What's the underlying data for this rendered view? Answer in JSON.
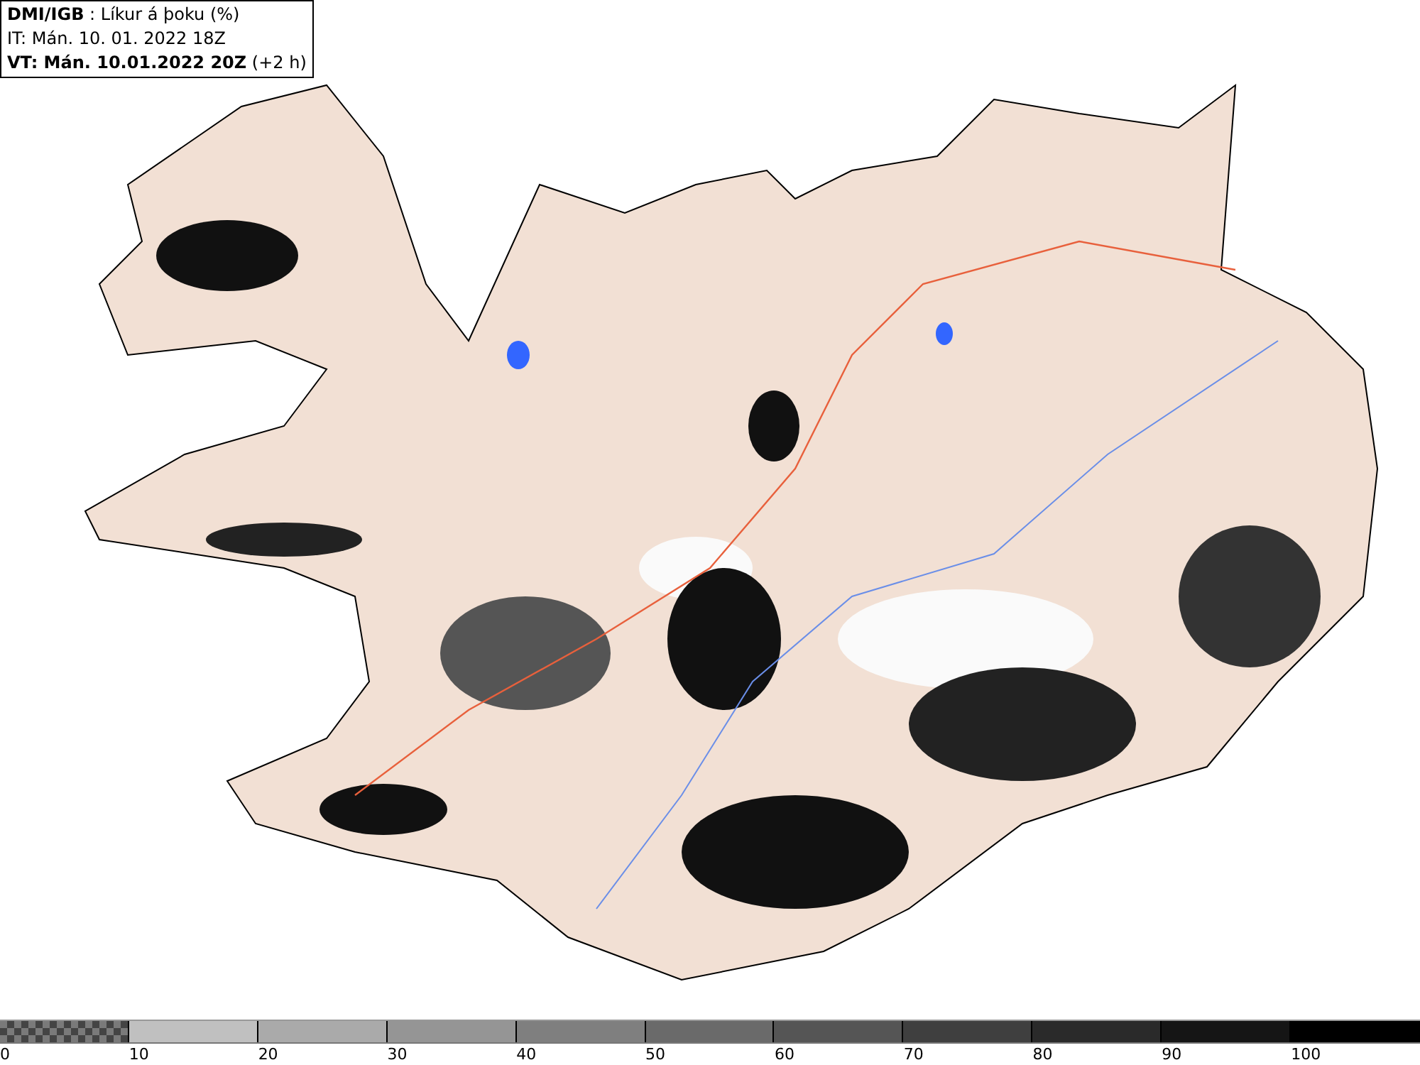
{
  "header": {
    "title": "**DMI/IGB** : Líkur á þoku (%)",
    "issue_time": "IT: Mán. 10. 01. 2022 18Z",
    "valid_time": "**VT: Mán. 10.01.2022 20Z** (+2 h)"
  },
  "legend": {
    "segments": [
      {
        "kind": "checker",
        "color": "#7a7a7a",
        "label": "0"
      },
      {
        "kind": "solid",
        "color": "#c0c0c0",
        "label": "10"
      },
      {
        "kind": "solid",
        "color": "#aaaaaa",
        "label": "20"
      },
      {
        "kind": "solid",
        "color": "#959595",
        "label": "30"
      },
      {
        "kind": "solid",
        "color": "#7f7f7f",
        "label": "40"
      },
      {
        "kind": "solid",
        "color": "#6a6a6a",
        "label": "50"
      },
      {
        "kind": "solid",
        "color": "#555555",
        "label": "60"
      },
      {
        "kind": "solid",
        "color": "#3f3f3f",
        "label": "70"
      },
      {
        "kind": "solid",
        "color": "#2a2a2a",
        "label": "80"
      },
      {
        "kind": "solid",
        "color": "#151515",
        "label": "90"
      },
      {
        "kind": "solid",
        "color": "#000000",
        "label": "100"
      }
    ]
  }
}
